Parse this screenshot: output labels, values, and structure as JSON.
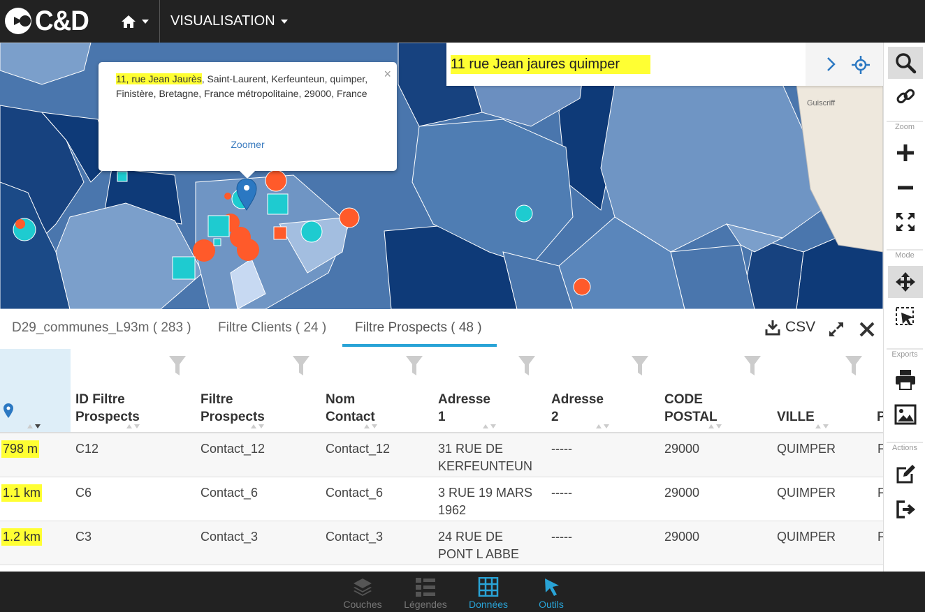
{
  "app": {
    "logo_text": "C&D",
    "menu_visualisation": "VISUALISATION"
  },
  "search": {
    "value": "11 rue Jean jaures quimper"
  },
  "map": {
    "place_label": "Guiscriff"
  },
  "popup": {
    "address_highlight": "11, rue Jean Jaurès",
    "address_rest": ", Saint-Laurent, Kerfeunteun, quimper, Finistère, Bretagne, France métropolitaine, 29000, France",
    "close": "×",
    "zoom_link": "Zoomer"
  },
  "toolbar": {
    "zoom_label": "Zoom",
    "mode_label": "Mode",
    "exports_label": "Exports",
    "actions_label": "Actions"
  },
  "tabs": [
    {
      "label": "D29_communes_L93m ( 283 )"
    },
    {
      "label": "Filtre Clients ( 24 )"
    },
    {
      "label": "Filtre Prospects ( 48 )"
    }
  ],
  "table_actions": {
    "csv_label": "CSV"
  },
  "table": {
    "headers": [
      {
        "line1": "",
        "line2": ""
      },
      {
        "line1": "ID Filtre",
        "line2": "Prospects"
      },
      {
        "line1": "Filtre",
        "line2": "Prospects"
      },
      {
        "line1": "Nom",
        "line2": "Contact"
      },
      {
        "line1": "Adresse",
        "line2": "1"
      },
      {
        "line1": "Adresse",
        "line2": "2"
      },
      {
        "line1": "CODE",
        "line2": "POSTAL"
      },
      {
        "line1": "",
        "line2": "VILLE"
      },
      {
        "line1": "",
        "line2": "P"
      }
    ],
    "rows": [
      {
        "distance": "798 m",
        "id": "C12",
        "filtre": "Contact_12",
        "nom": "Contact_12",
        "adresse1_a": "31 RUE DE",
        "adresse1_b": "KERFEUNTEUN",
        "adresse2": "-----",
        "cp": "29000",
        "ville": "QUIMPER",
        "p": "F"
      },
      {
        "distance": "1.1 km",
        "id": "C6",
        "filtre": "Contact_6",
        "nom": "Contact_6",
        "adresse1_a": "3 RUE 19 MARS",
        "adresse1_b": "1962",
        "adresse2": "-----",
        "cp": "29000",
        "ville": "QUIMPER",
        "p": "F"
      },
      {
        "distance": "1.2 km",
        "id": "C3",
        "filtre": "Contact_3",
        "nom": "Contact_3",
        "adresse1_a": "24 RUE DE",
        "adresse1_b": "PONT L ABBE",
        "adresse2": "-----",
        "cp": "29000",
        "ville": "QUIMPER",
        "p": "F"
      }
    ]
  },
  "bottom_nav": [
    {
      "label": "Couches",
      "color": "#777777"
    },
    {
      "label": "Légendes",
      "color": "#777777"
    },
    {
      "label": "Données",
      "color": "#29a3d6"
    },
    {
      "label": "Outils",
      "color": "#29a3d6"
    }
  ],
  "colors": {
    "accent": "#29a3d6",
    "highlight": "#ffff33",
    "prospect_marker": "#ff5a2a",
    "client_marker": "#1ecbd0",
    "map_dark": "#0e3a78",
    "map_mid": "#4a76ad",
    "map_light": "#7b9fcb"
  }
}
